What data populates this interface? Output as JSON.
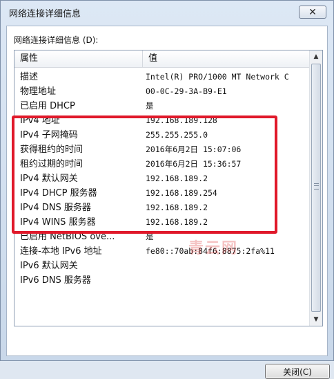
{
  "window": {
    "title": "网络连接详细信息",
    "close_icon": "close-icon"
  },
  "details_label": "网络连接详细信息 (D):",
  "table": {
    "headers": [
      "属性",
      "值"
    ],
    "rows": [
      {
        "property": "描述",
        "value": "Intel(R) PRO/1000 MT Network C"
      },
      {
        "property": "物理地址",
        "value": "00-0C-29-3A-B9-E1"
      },
      {
        "property": "已启用 DHCP",
        "value": "是"
      },
      {
        "property": "IPv4 地址",
        "value": "192.168.189.128"
      },
      {
        "property": "IPv4 子网掩码",
        "value": "255.255.255.0"
      },
      {
        "property": "获得租约的时间",
        "value": "2016年6月2日 15:07:06"
      },
      {
        "property": "租约过期的时间",
        "value": "2016年6月2日 15:36:57"
      },
      {
        "property": "IPv4 默认网关",
        "value": "192.168.189.2"
      },
      {
        "property": "IPv4 DHCP 服务器",
        "value": "192.168.189.254"
      },
      {
        "property": "IPv4 DNS 服务器",
        "value": "192.168.189.2"
      },
      {
        "property": "IPv4 WINS 服务器",
        "value": "192.168.189.2"
      },
      {
        "property": "已启用 NetBIOS ove...",
        "value": "是"
      },
      {
        "property": "连接-本地 IPv6 地址",
        "value": "fe80::70ab:84f6:8875:2fa%11"
      },
      {
        "property": "IPv6 默认网关",
        "value": ""
      },
      {
        "property": "IPv6 DNS 服务器",
        "value": ""
      }
    ]
  },
  "scrollbar": {
    "up_arrow": "▲",
    "down_arrow": "▼"
  },
  "watermark": "青云网",
  "close_button_label": "关闭(C)",
  "colors": {
    "highlight": "#e0192a"
  }
}
